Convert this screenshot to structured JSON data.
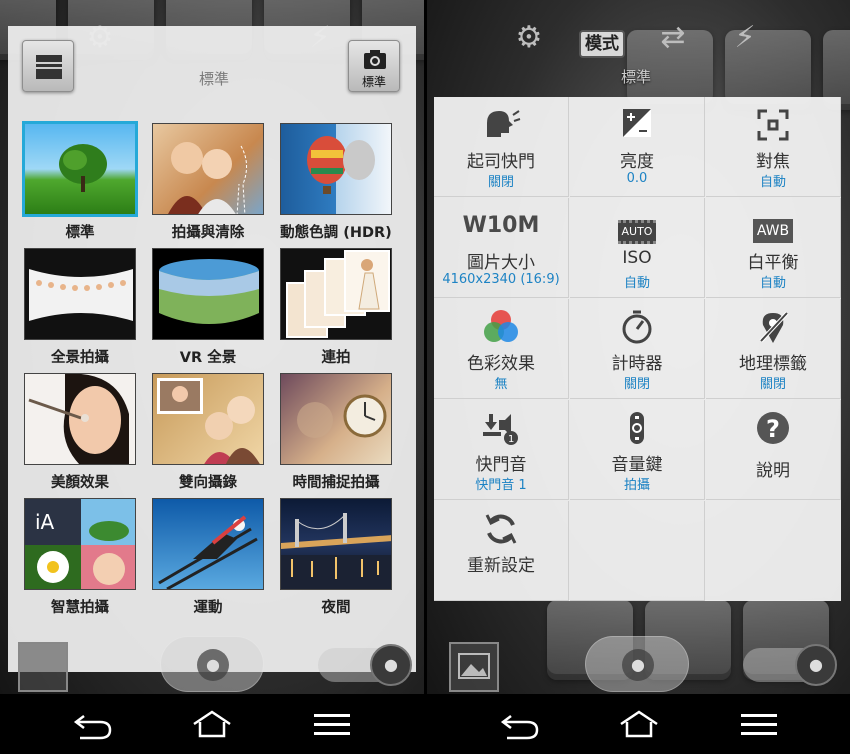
{
  "left": {
    "top_label": "標準",
    "camera_button_label": "標準",
    "modes": [
      {
        "label": "標準",
        "selected": true
      },
      {
        "label": "拍攝與清除",
        "selected": false
      },
      {
        "label": "動態色調 (HDR)",
        "selected": false
      },
      {
        "label": "全景拍攝",
        "selected": false
      },
      {
        "label": "VR 全景",
        "selected": false
      },
      {
        "label": "連拍",
        "selected": false
      },
      {
        "label": "美顏效果",
        "selected": false
      },
      {
        "label": "雙向攝錄",
        "selected": false
      },
      {
        "label": "時間捕捉拍攝",
        "selected": false
      },
      {
        "label": "智慧拍攝",
        "selected": false
      },
      {
        "label": "運動",
        "selected": false
      },
      {
        "label": "夜間",
        "selected": false
      }
    ]
  },
  "right": {
    "mode_badge": "模式",
    "sub_label": "標準",
    "settings": [
      {
        "icon": "voice-shutter-icon",
        "name": "起司快門",
        "value": "關閉"
      },
      {
        "icon": "brightness-icon",
        "name": "亮度",
        "value": "0.0"
      },
      {
        "icon": "focus-icon",
        "name": "對焦",
        "value": "自動"
      },
      {
        "icon": "resolution-icon",
        "icon_text": "W10M",
        "name": "圖片大小",
        "value": "4160x2340 (16:9)"
      },
      {
        "icon": "iso-icon",
        "icon_text": "AUTO",
        "name": "ISO",
        "value": "自動"
      },
      {
        "icon": "awb-icon",
        "icon_text": "AWB",
        "name": "白平衡",
        "value": "自動"
      },
      {
        "icon": "color-effect-icon",
        "name": "色彩效果",
        "value": "無"
      },
      {
        "icon": "timer-icon",
        "name": "計時器",
        "value": "關閉"
      },
      {
        "icon": "geotag-icon",
        "name": "地理標籤",
        "value": "關閉"
      },
      {
        "icon": "shutter-sound-icon",
        "name": "快門音",
        "value": "快門音 1"
      },
      {
        "icon": "volume-key-icon",
        "name": "音量鍵",
        "value": "拍攝"
      },
      {
        "icon": "help-icon",
        "name": "說明",
        "value": ""
      },
      {
        "icon": "reset-icon",
        "name": "重新設定",
        "value": ""
      }
    ]
  },
  "colors": {
    "accent": "#1d83c4",
    "selection": "#25a9d8"
  }
}
